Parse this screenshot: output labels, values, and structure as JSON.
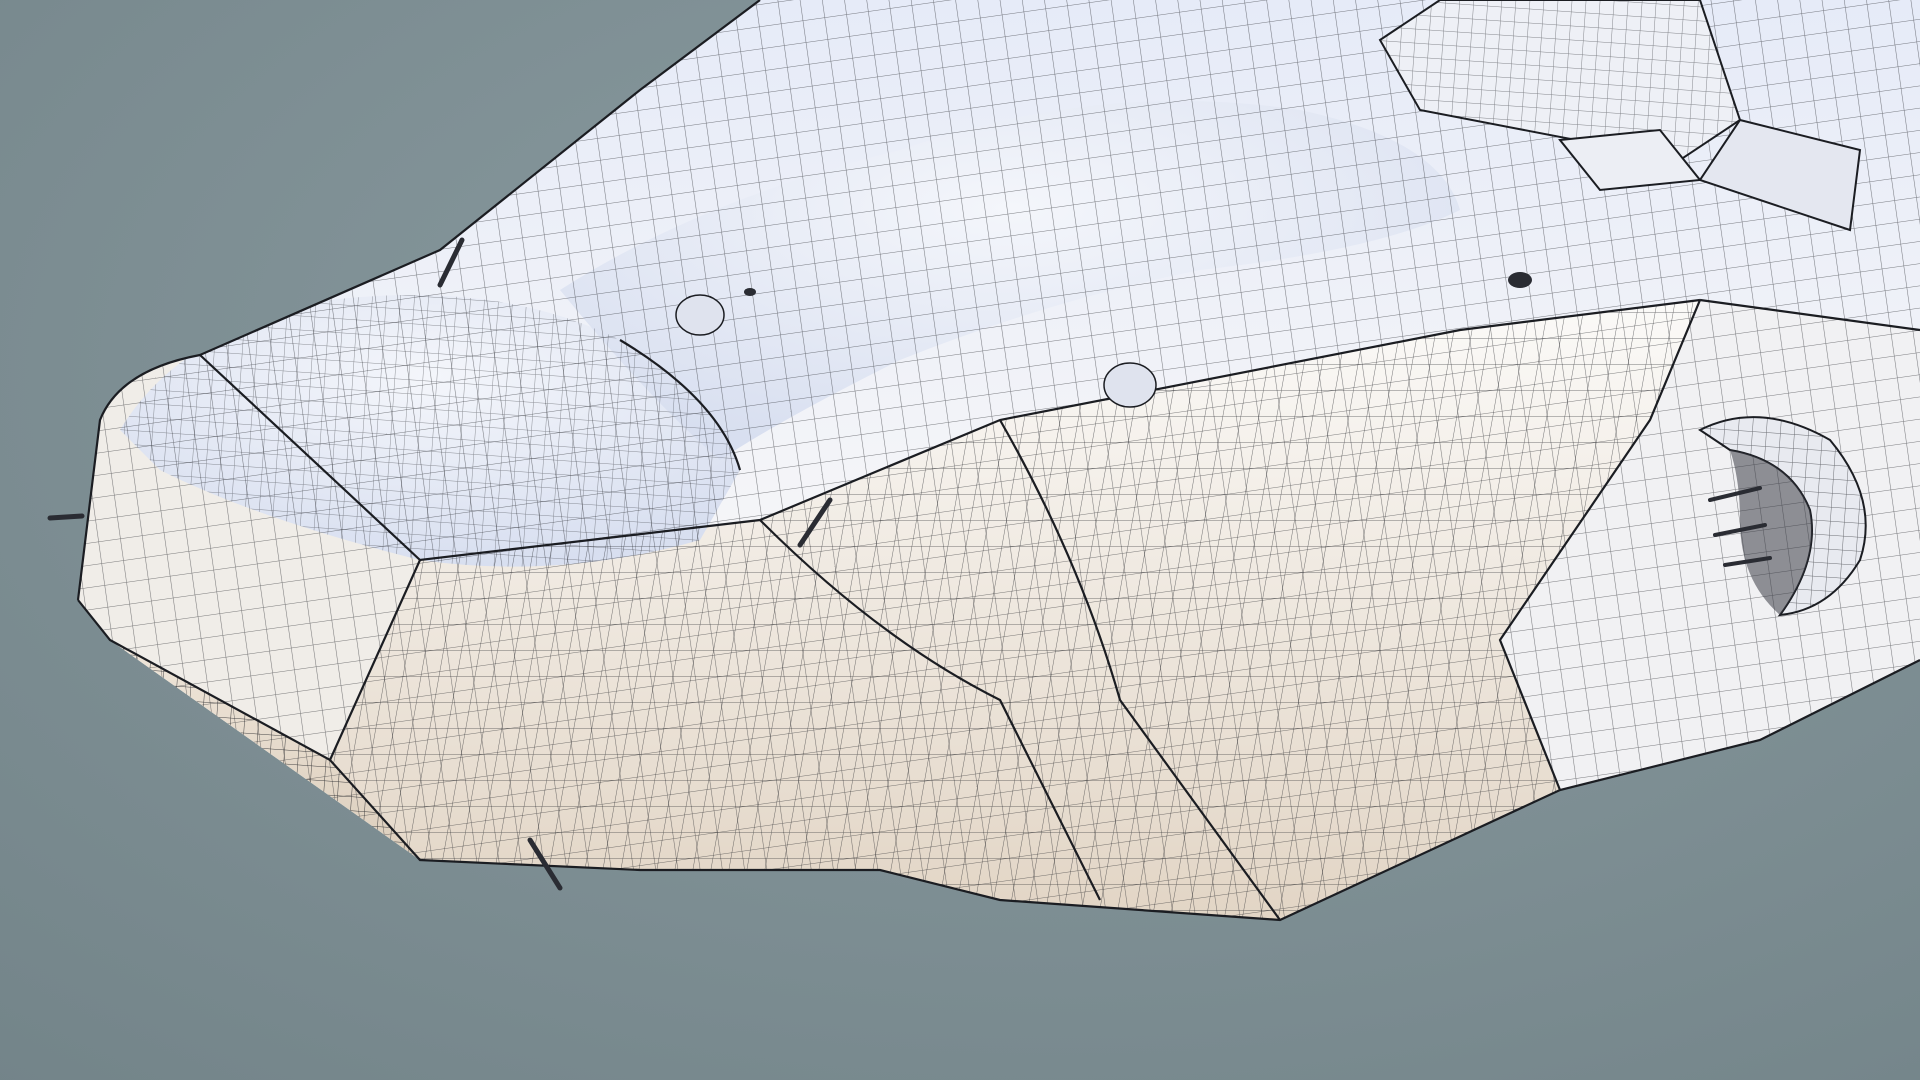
{
  "scene": {
    "subject": "spaceship-hull-wireframe",
    "background_color": "#7d8e93",
    "hull_color": "#f2f2f4",
    "hull_shadow_color": "#d9cfc2",
    "wire_color": "#1b1d22"
  }
}
